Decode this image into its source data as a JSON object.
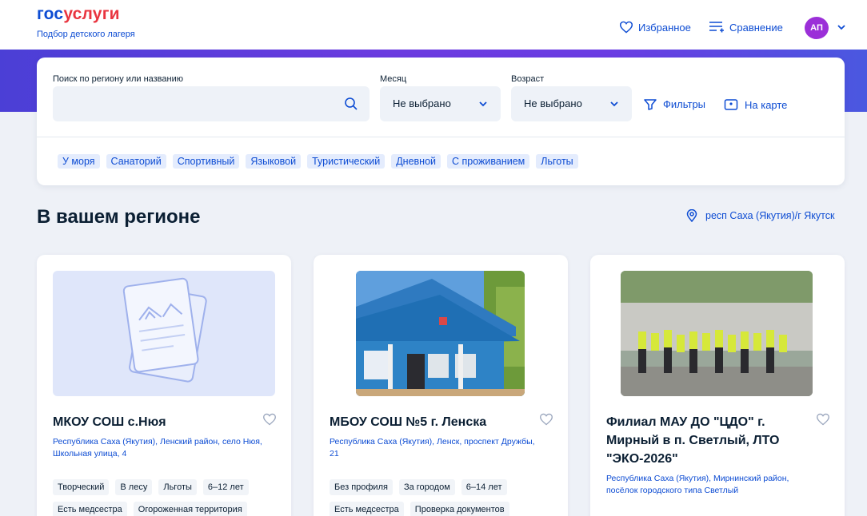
{
  "header": {
    "logo_part1": "гос",
    "logo_part2": "услуги",
    "subtitle": "Подбор детского лагеря",
    "favorites": "Избранное",
    "compare": "Сравнение",
    "avatar": "АП"
  },
  "search": {
    "query_label": "Поиск по региону или названию",
    "query_value": "",
    "month_label": "Месяц",
    "month_value": "Не выбрано",
    "age_label": "Возраст",
    "age_value": "Не выбрано",
    "filters": "Фильтры",
    "map": "На карте",
    "tags": [
      "У моря",
      "Санаторий",
      "Спортивный",
      "Языковой",
      "Туристический",
      "Дневной",
      "С проживанием",
      "Льготы"
    ]
  },
  "section": {
    "title": "В вашем регионе",
    "region": "респ Саха (Якутия)/г Якутск"
  },
  "cards": [
    {
      "title": "МКОУ СОШ с.Нюя",
      "address": "Республика Саха (Якутия), Ленский район, село Нюя, Школьная улица, 4",
      "chips": [
        "Творческий",
        "В лесу",
        "Льготы",
        "6–12 лет",
        "Есть медсестра",
        "Огороженная территория"
      ]
    },
    {
      "title": "МБОУ СОШ №5 г. Ленска",
      "address": "Республика Саха (Якутия), Ленск, проспект Дружбы, 21",
      "chips": [
        "Без профиля",
        "За городом",
        "6–14 лет",
        "Есть медсестра",
        "Проверка документов"
      ]
    },
    {
      "title": "Филиал МАУ ДО \"ЦДО\" г. Мирный в п. Светлый, ЛТО \"ЭКО-2026\"",
      "address": "Республика Саха (Якутия), Мирнинский район, посёлок городского типа Светлый",
      "chips": []
    }
  ],
  "colors": {
    "brand_blue": "#0d4cd3",
    "brand_red": "#e9343f",
    "avatar": "#9b2fd8"
  }
}
